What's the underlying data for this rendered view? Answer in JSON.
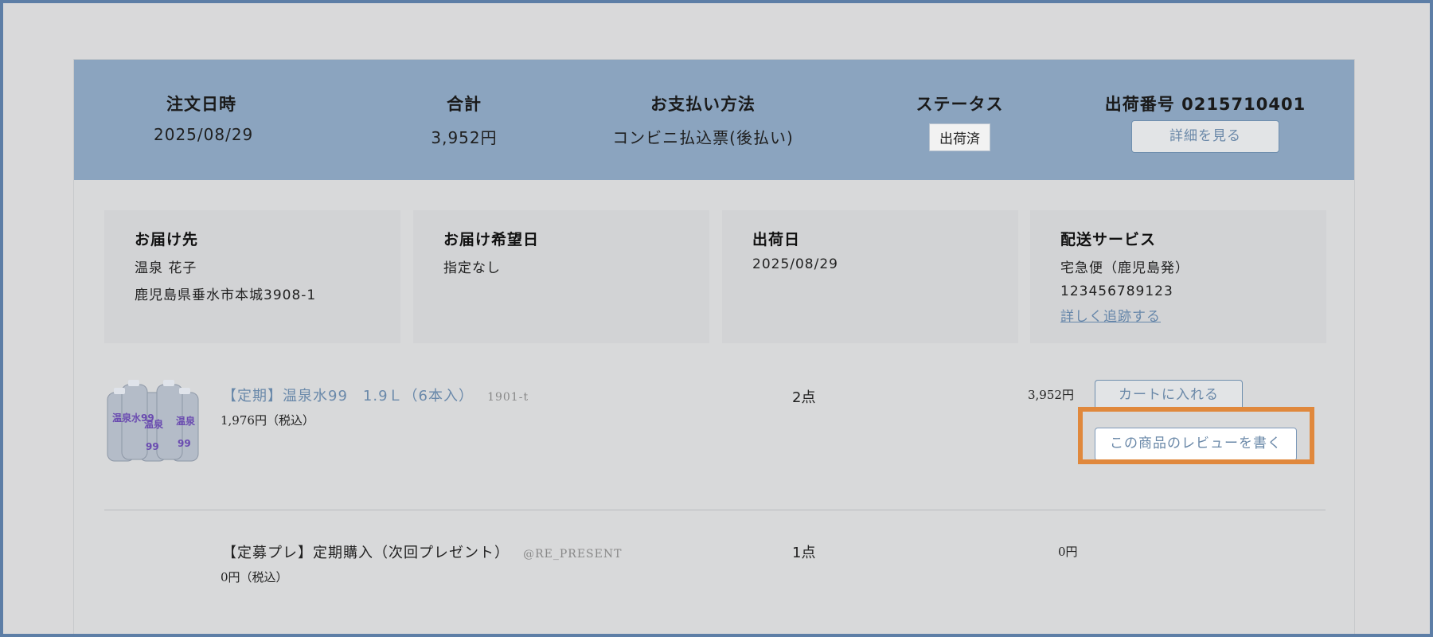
{
  "order_header": {
    "date_label": "注文日時",
    "date_value": "2025/08/29",
    "total_label": "合計",
    "total_value": "3,952円",
    "payment_label": "お支払い方法",
    "payment_value": "コンビニ払込票(後払い)",
    "status_label": "ステータス",
    "status_value": "出荷済",
    "shipment_label": "出荷番号 0215710401",
    "details_button": "詳細を見る"
  },
  "delivery_info": [
    {
      "title": "お届け先",
      "line1": "温泉 花子",
      "line2": "鹿児島県垂水市本城3908-1"
    },
    {
      "title": "お届け希望日",
      "line1": "指定なし"
    },
    {
      "title": "出荷日",
      "line1": "2025/08/29"
    },
    {
      "title": "配送サービス",
      "line1": "宅急便（鹿児島発）",
      "line2": "123456789123",
      "link": "詳しく追跡する"
    }
  ],
  "items": [
    {
      "name": "【定期】温泉水99　1.9Ｌ（6本入）",
      "sku": "1901-t",
      "unit_price": "1,976円（税込）",
      "quantity": "2点",
      "subtotal": "3,952円",
      "cart_button": "カートに入れる",
      "review_button": "この商品のレビューを書く",
      "image_text": "温泉水99"
    },
    {
      "name": "【定募プレ】定期購入（次回プレゼント）",
      "sku": "@RE_PRESENT",
      "unit_price": "0円（税込）",
      "quantity": "1点",
      "subtotal": "0円"
    }
  ]
}
